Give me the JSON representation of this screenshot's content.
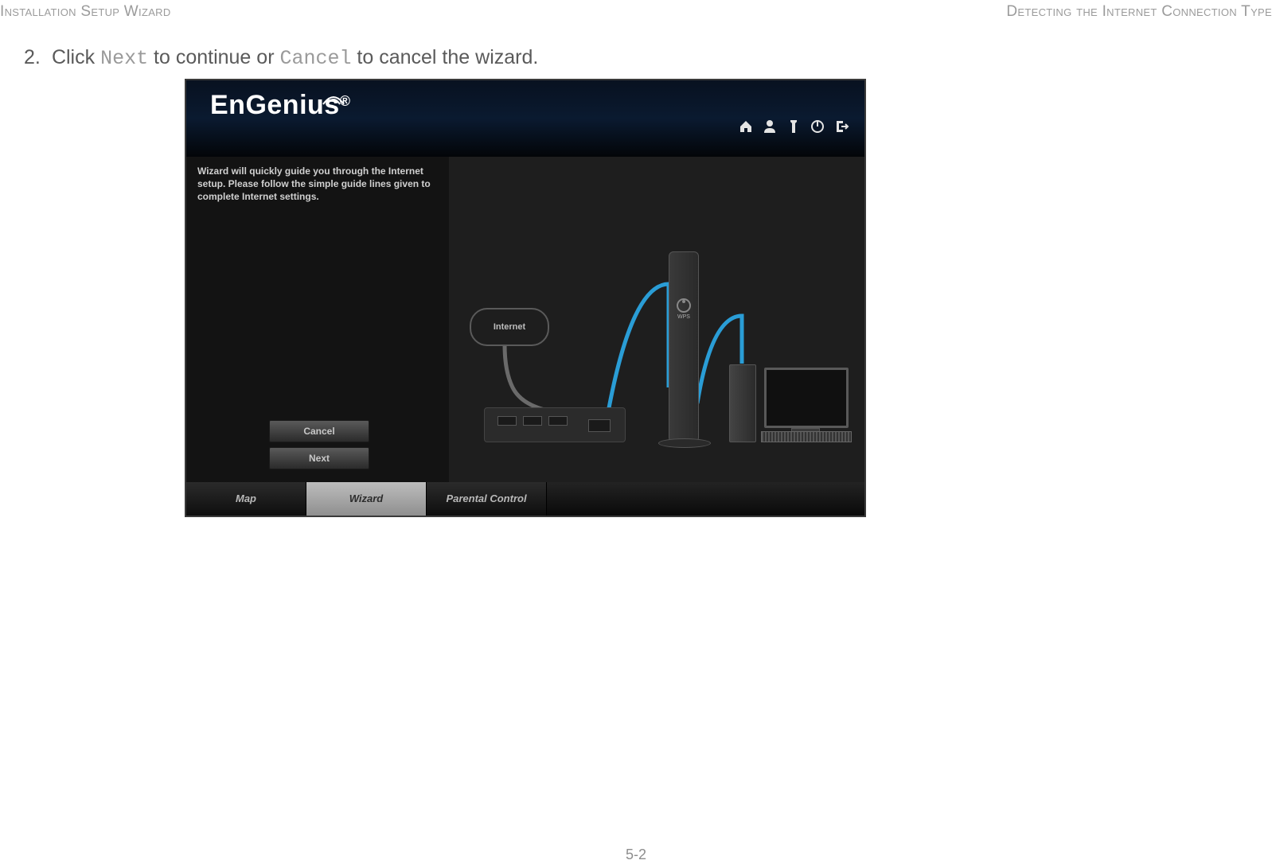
{
  "document": {
    "header_left": "Installation Setup Wizard",
    "header_right": "Detecting the Internet Connection Type",
    "step_number": "2.",
    "instruction_pre": "Click ",
    "instruction_code1": "Next",
    "instruction_mid": " to continue or ",
    "instruction_code2": "Cancel",
    "instruction_post": " to cancel the wizard.",
    "page_number": "5-2"
  },
  "app": {
    "logo_text": "EnGenius",
    "logo_reg": "®",
    "toolbar_icons": {
      "home": "home-icon",
      "user": "user-icon",
      "tool": "tool-icon",
      "power": "power-icon",
      "logout": "logout-icon"
    },
    "wizard_text": "Wizard will quickly guide you through the Internet setup. Please follow the simple guide lines given to complete Internet settings.",
    "buttons": {
      "cancel": "Cancel",
      "next": "Next"
    },
    "diagram": {
      "cloud_label": "Internet",
      "wps_label": "WPS"
    },
    "nav": {
      "map": "Map",
      "wizard": "Wizard",
      "parental": "Parental Control"
    }
  }
}
